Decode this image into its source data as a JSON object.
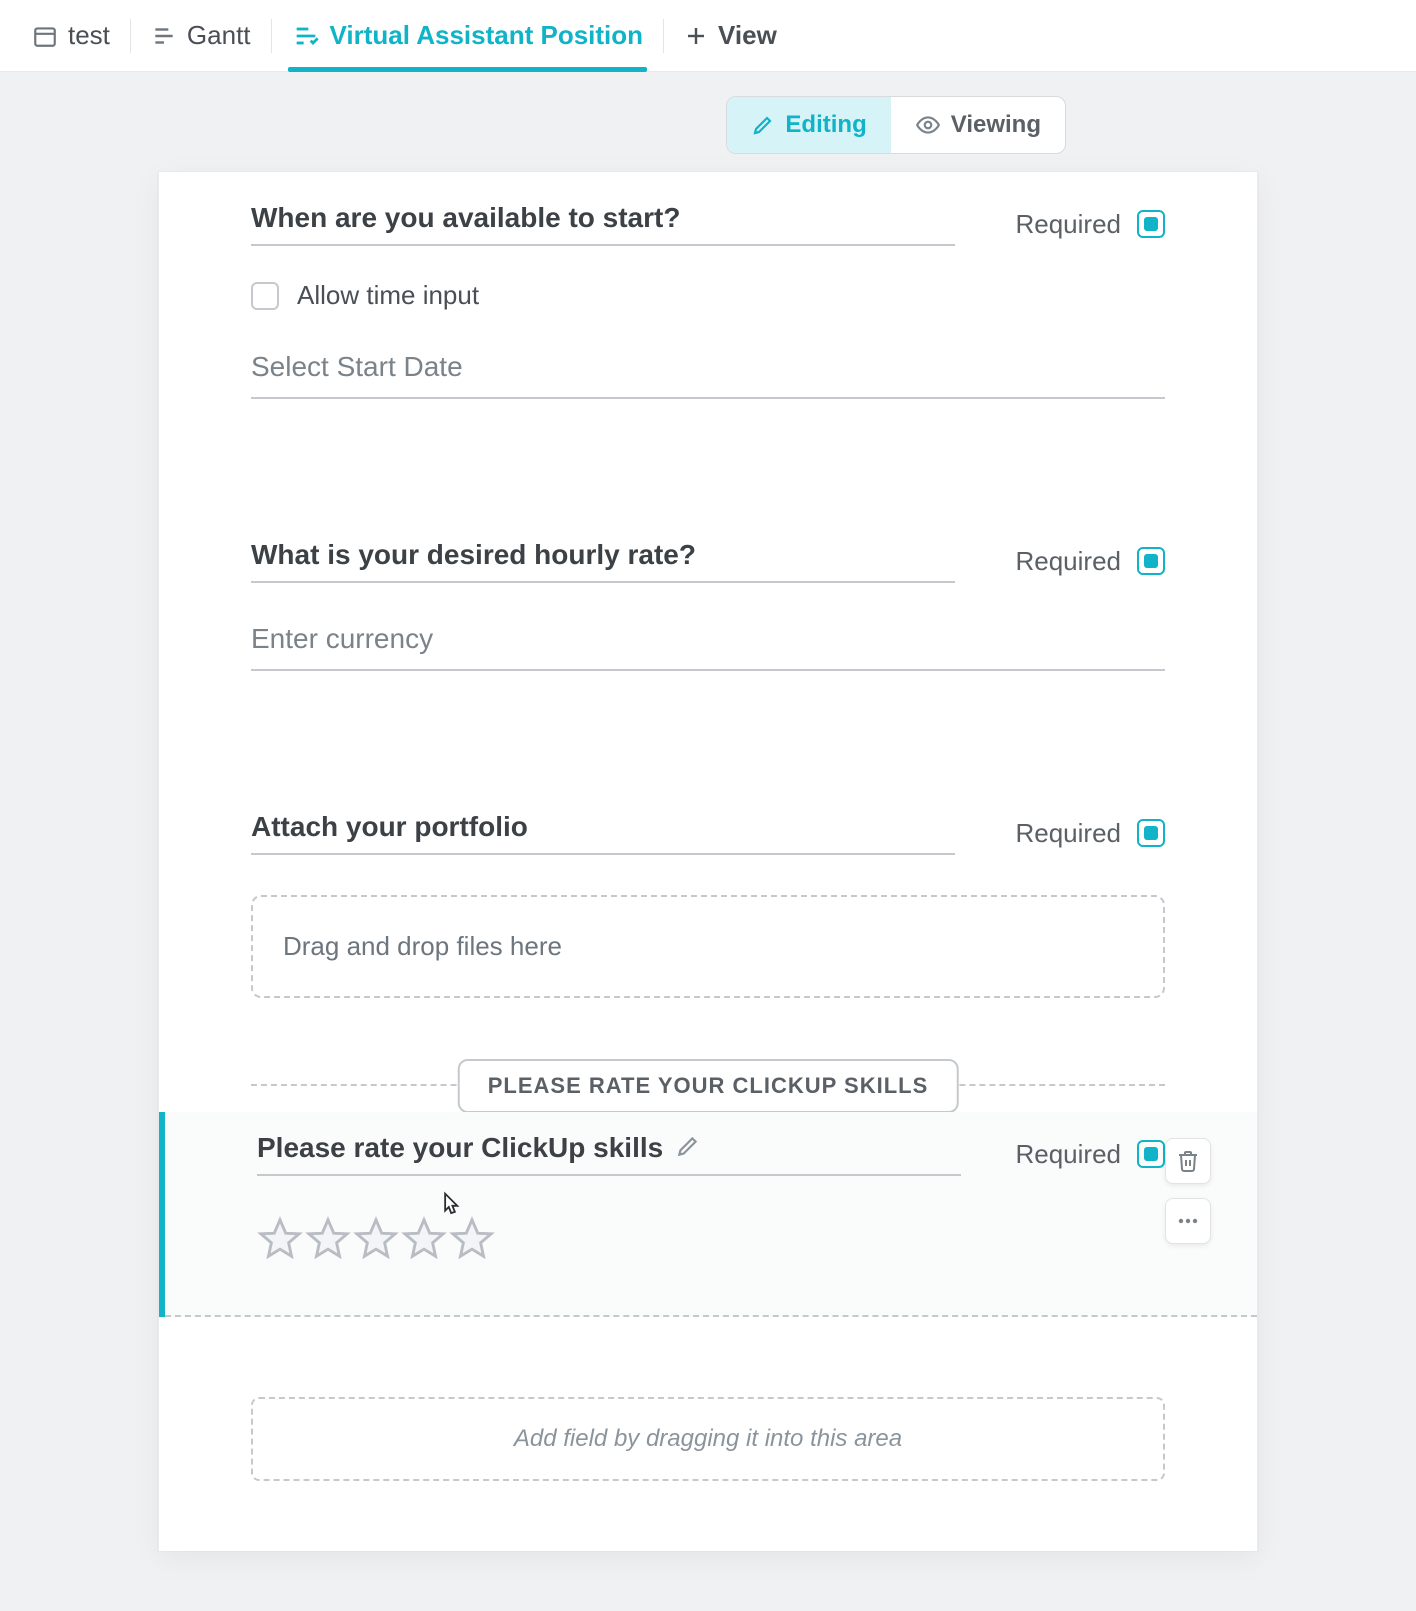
{
  "tabs": {
    "items": [
      {
        "label": "test"
      },
      {
        "label": "Gantt"
      },
      {
        "label": "Virtual Assistant Position"
      }
    ],
    "add_label": "View"
  },
  "mode": {
    "editing": "Editing",
    "viewing": "Viewing"
  },
  "fields": {
    "start": {
      "label": "When are you available to start?",
      "required_label": "Required",
      "allow_time": "Allow time input",
      "placeholder": "Select Start Date"
    },
    "rate": {
      "label": "What is your desired hourly rate?",
      "required_label": "Required",
      "placeholder": "Enter currency"
    },
    "portfolio": {
      "label": "Attach your portfolio",
      "required_label": "Required",
      "dropzone": "Drag and drop files here"
    },
    "skills": {
      "section_title": "PLEASE RATE YOUR CLICKUP SKILLS",
      "label": "Please rate your ClickUp skills",
      "required_label": "Required"
    }
  },
  "add_field_hint": "Add field by dragging it into this area"
}
